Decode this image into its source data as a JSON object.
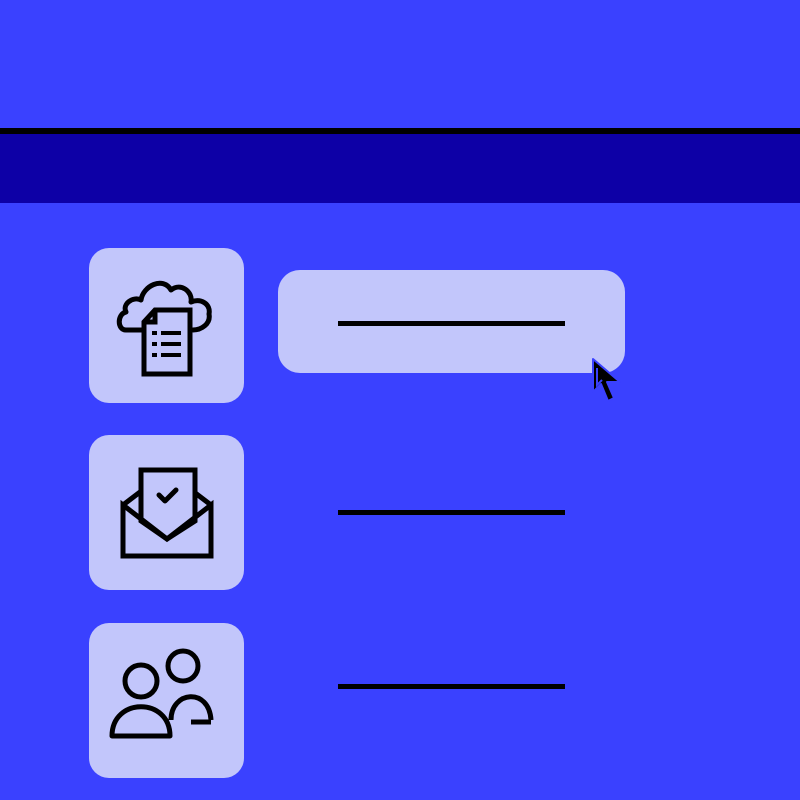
{
  "header": {
    "title": ""
  },
  "nav": {
    "label": ""
  },
  "menu": {
    "items": [
      {
        "icon": "cloud-document-icon",
        "label": "",
        "selected": true
      },
      {
        "icon": "mail-check-icon",
        "label": "",
        "selected": false
      },
      {
        "icon": "users-icon",
        "label": "",
        "selected": false
      }
    ]
  },
  "colors": {
    "background": "#3a41ff",
    "nav_bar": "#0d00a6",
    "tile": "#c2c6fb",
    "highlight": "#c2c6fb",
    "stroke": "#000000"
  },
  "pointer": {
    "icon": "mouse-pointer-icon"
  }
}
